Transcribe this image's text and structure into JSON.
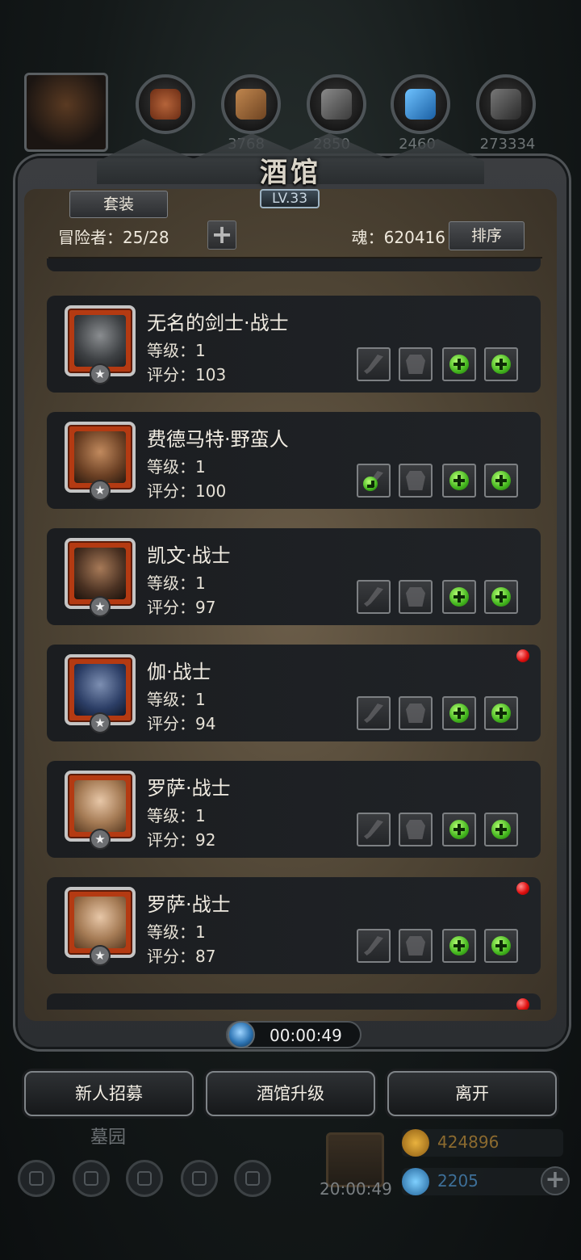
{
  "resources": {
    "counts": [
      "",
      "3768",
      "2850",
      "2460",
      "273334"
    ]
  },
  "panel": {
    "title": "酒馆",
    "level": "LV.33",
    "outfit_button": "套装",
    "adventurers": "冒险者：25/28",
    "add_slot_button": "+",
    "soul": "魂：620416",
    "sort_button": "排序"
  },
  "heroes": [
    {
      "name": "无名的剑士·战士",
      "level": "等级：1",
      "score": "评分：103",
      "weapon_equipped": false,
      "new": false
    },
    {
      "name": "费德马特·野蛮人",
      "level": "等级：1",
      "score": "评分：100",
      "weapon_equipped": false,
      "new": false
    },
    {
      "name": "凯文·战士",
      "level": "等级：1",
      "score": "评分：97",
      "weapon_equipped": false,
      "new": false
    },
    {
      "name": "伽·战士",
      "level": "等级：1",
      "score": "评分：94",
      "weapon_equipped": false,
      "new": true
    },
    {
      "name": "罗萨·战士",
      "level": "等级：1",
      "score": "评分：92",
      "weapon_equipped": false,
      "new": false
    },
    {
      "name": "罗萨·战士",
      "level": "等级：1",
      "score": "评分：87",
      "weapon_equipped": false,
      "new": true
    }
  ],
  "timer": "00:00:49",
  "buttons": {
    "recruit": "新人招募",
    "upgrade": "酒馆升级",
    "leave": "离开"
  },
  "background_hud": {
    "graveyard": "墓园",
    "gift_timer": "20:00:49",
    "gold": "424896",
    "gems": "2205",
    "add_button": "+"
  },
  "colors": {
    "green_plus": "#43b51e",
    "red_dot": "#e01010",
    "portrait_border": "#b43a12"
  }
}
